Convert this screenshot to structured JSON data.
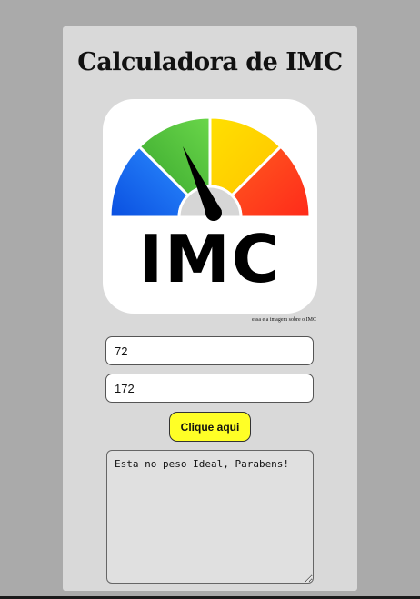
{
  "page": {
    "title": "Calculadora de IMC",
    "logo_text": "IMC",
    "image_caption": "essa e a imagem sobre o IMC"
  },
  "form": {
    "weight_value": "72",
    "height_value": "172",
    "submit_label": "Clique aqui"
  },
  "result": {
    "message": "Esta no peso Ideal, Parabens!"
  },
  "colors": {
    "page_background": "#aaaaaa",
    "card_background": "#d9d9d9",
    "button_background": "#ffff26",
    "gauge_blue": "#1a6cf0",
    "gauge_green": "#4cc23a",
    "gauge_yellow": "#ffd500",
    "gauge_red": "#ff3b1f"
  },
  "icons": {
    "logo": "imc-gauge-icon"
  }
}
